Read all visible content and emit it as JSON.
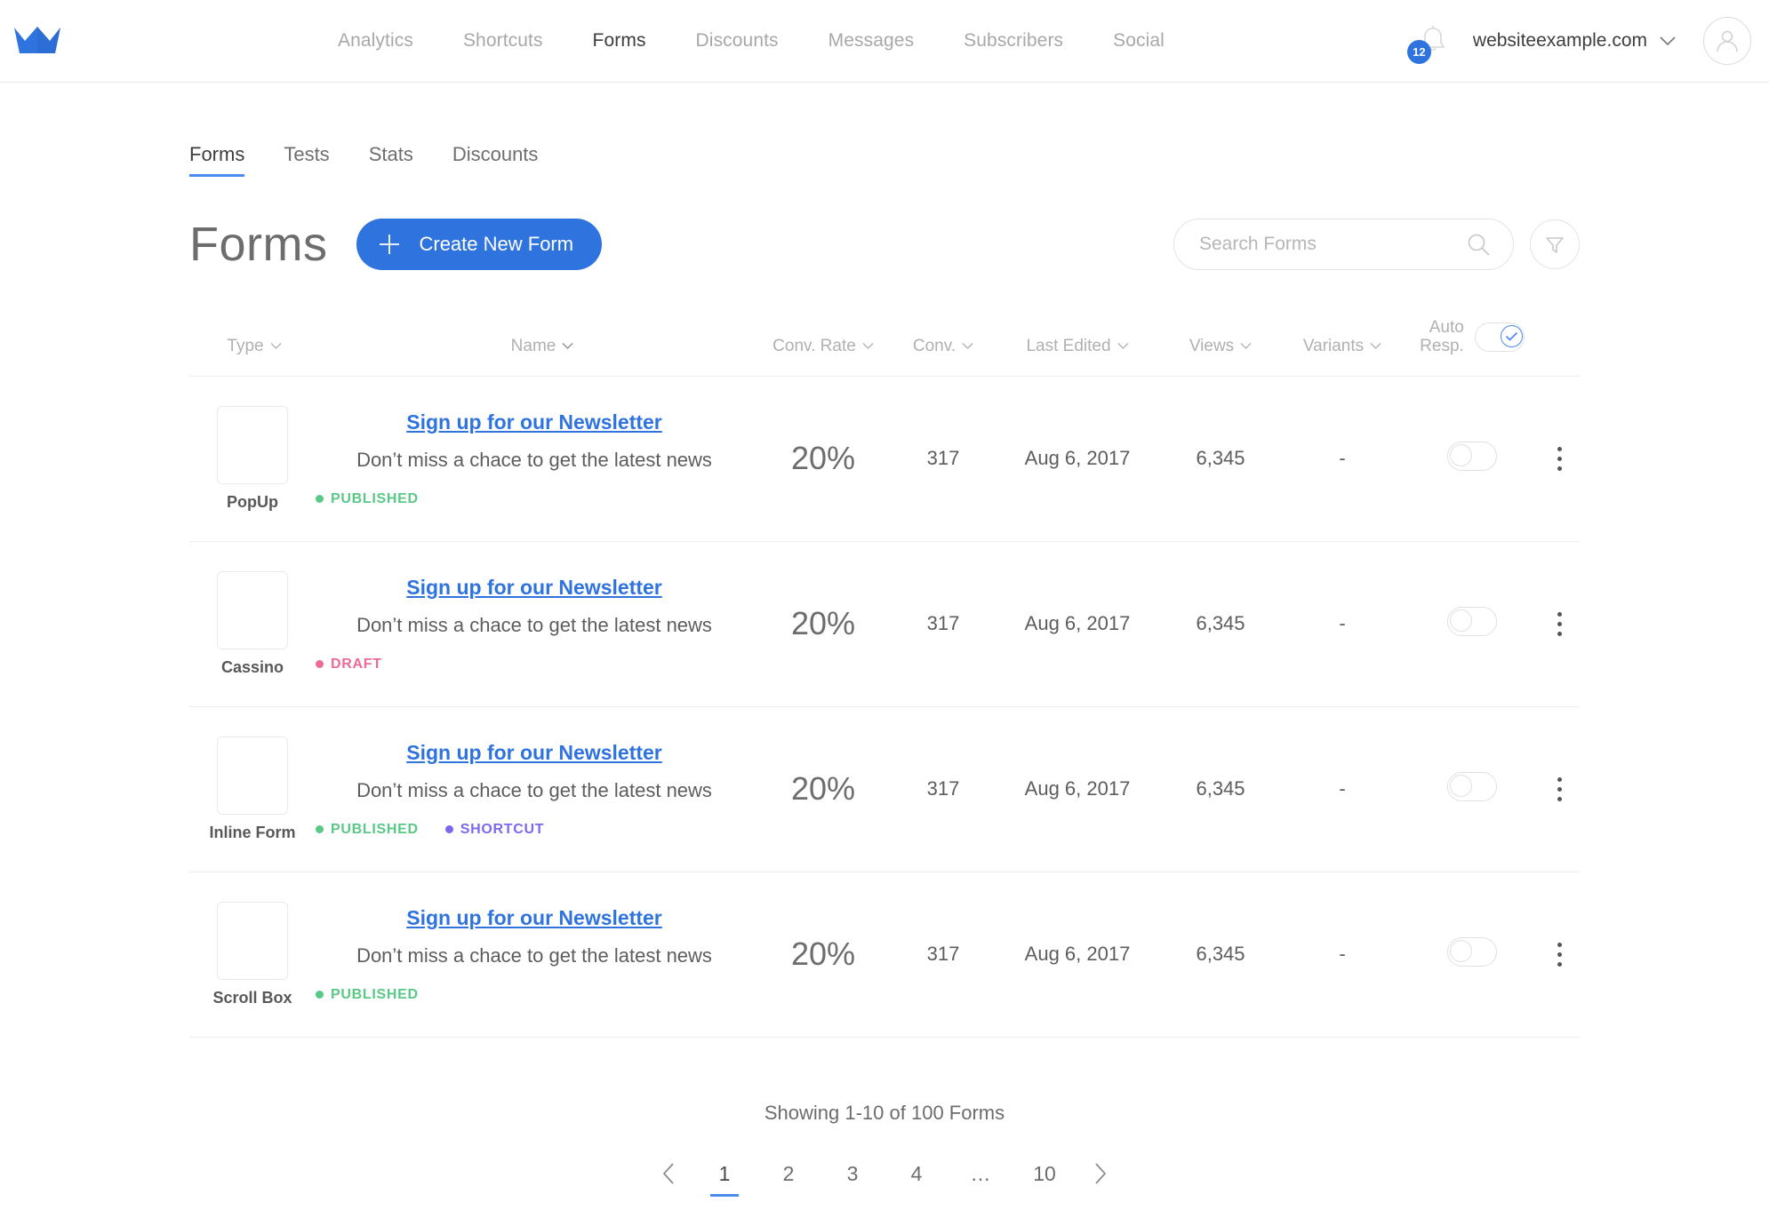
{
  "brand": {
    "logo_icon": "crown-icon",
    "accent_color": "#2f73df"
  },
  "topnav": {
    "items": [
      {
        "label": "Analytics",
        "active": false
      },
      {
        "label": "Shortcuts",
        "active": false
      },
      {
        "label": "Forms",
        "active": true
      },
      {
        "label": "Discounts",
        "active": false
      },
      {
        "label": "Messages",
        "active": false
      },
      {
        "label": "Subscribers",
        "active": false
      },
      {
        "label": "Social",
        "active": false
      }
    ],
    "notifications": {
      "icon": "bell-icon",
      "count": "12"
    },
    "account": {
      "name": "websiteexample.com",
      "chevron": "chevron-down-icon",
      "avatar": "user-avatar-icon"
    }
  },
  "subtabs": [
    {
      "label": "Forms",
      "active": true
    },
    {
      "label": "Tests",
      "active": false
    },
    {
      "label": "Stats",
      "active": false
    },
    {
      "label": "Discounts",
      "active": false
    }
  ],
  "page": {
    "title": "Forms",
    "create_button": "Create New Form",
    "create_icon": "plus-icon"
  },
  "search": {
    "placeholder": "Search Forms",
    "value": "",
    "icon": "search-icon",
    "filter_icon": "filter-icon"
  },
  "table": {
    "columns": [
      {
        "label": "Type",
        "sort_icon": "chevron-down-icon"
      },
      {
        "label": "Name",
        "sort_icon": "chevron-down-icon"
      },
      {
        "label": "Conv. Rate",
        "sort_icon": "chevron-down-icon"
      },
      {
        "label": "Conv.",
        "sort_icon": "chevron-down-icon"
      },
      {
        "label": "Last Edited",
        "sort_icon": "chevron-down-icon"
      },
      {
        "label": "Views",
        "sort_icon": "chevron-down-icon"
      },
      {
        "label": "Variants",
        "sort_icon": "chevron-down-icon"
      }
    ],
    "auto_resp": {
      "line1": "Auto",
      "line2": "Resp.",
      "toggle_on": true
    },
    "rows": [
      {
        "type": "PopUp",
        "name": "Sign up for our Newsletter",
        "description": "Don’t miss a chace to get the latest news",
        "badges": [
          {
            "text": "PUBLISHED",
            "color": "#5ac887"
          }
        ],
        "conv_rate": "20%",
        "conv": "317",
        "last_edited": "Aug 6, 2017",
        "views": "6,345",
        "variants": "-",
        "auto_resp_on": false
      },
      {
        "type": "Cassino",
        "name": "Sign up for our Newsletter",
        "description": "Don’t miss a chace to get the latest news",
        "badges": [
          {
            "text": "DRAFT",
            "color": "#ed6b96"
          }
        ],
        "conv_rate": "20%",
        "conv": "317",
        "last_edited": "Aug 6, 2017",
        "views": "6,345",
        "variants": "-",
        "auto_resp_on": false
      },
      {
        "type": "Inline Form",
        "name": "Sign up for our Newsletter",
        "description": "Don’t miss a chace to get the latest news",
        "badges": [
          {
            "text": "PUBLISHED",
            "color": "#5ac887"
          },
          {
            "text": "SHORTCUT",
            "color": "#7b68ee"
          }
        ],
        "conv_rate": "20%",
        "conv": "317",
        "last_edited": "Aug 6, 2017",
        "views": "6,345",
        "variants": "-",
        "auto_resp_on": false
      },
      {
        "type": "Scroll Box",
        "name": "Sign up for our Newsletter",
        "description": "Don’t miss a chace to get the latest news",
        "badges": [
          {
            "text": "PUBLISHED",
            "color": "#5ac887"
          }
        ],
        "conv_rate": "20%",
        "conv": "317",
        "last_edited": "Aug 6, 2017",
        "views": "6,345",
        "variants": "-",
        "auto_resp_on": false
      }
    ]
  },
  "footer": {
    "showing": "Showing 1-10 of 100 Forms",
    "prev_icon": "chevron-left-icon",
    "next_icon": "chevron-right-icon",
    "pages": [
      {
        "label": "1",
        "active": true
      },
      {
        "label": "2",
        "active": false
      },
      {
        "label": "3",
        "active": false
      },
      {
        "label": "4",
        "active": false
      },
      {
        "label": "…",
        "active": false
      },
      {
        "label": "10",
        "active": false
      }
    ]
  }
}
